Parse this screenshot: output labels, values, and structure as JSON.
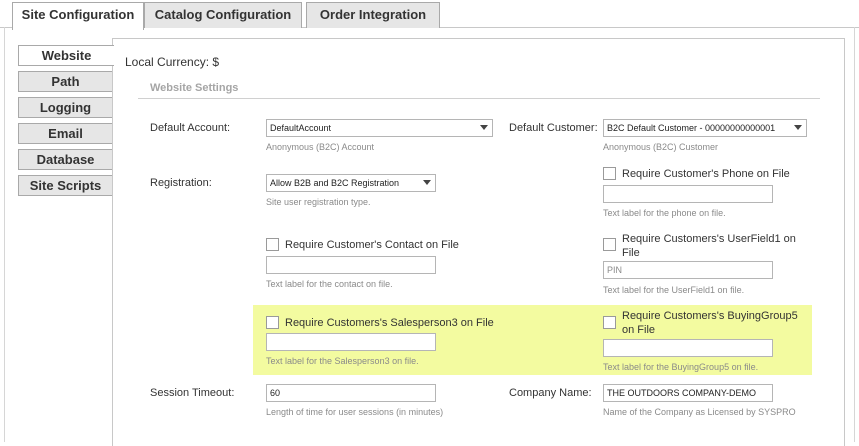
{
  "top_tabs": [
    "Site Configuration",
    "Catalog Configuration",
    "Order Integration"
  ],
  "side_tabs": [
    "Website",
    "Path",
    "Logging",
    "Email",
    "Database",
    "Site Scripts"
  ],
  "currency_label": "Local Currency: $",
  "section_title": "Website Settings",
  "default_account": {
    "label": "Default Account:",
    "value": "DefaultAccount",
    "hint": "Anonymous (B2C) Account"
  },
  "default_customer": {
    "label": "Default Customer:",
    "value": "B2C Default Customer - 00000000000001",
    "hint": "Anonymous (B2C) Customer"
  },
  "registration": {
    "label": "Registration:",
    "value": "Allow B2B and B2C Registration",
    "hint": "Site user registration type."
  },
  "phone": {
    "checkbox_label": "Require Customer's Phone on File",
    "value": "",
    "hint": "Text label for the phone on file."
  },
  "contact": {
    "checkbox_label": "Require Customer's Contact on File",
    "value": "",
    "hint": "Text label for the contact on file."
  },
  "userfield1": {
    "checkbox_label_1": "Require Customers's UserField1 on",
    "checkbox_label_2": "File",
    "value": "PIN",
    "hint": "Text label for the UserField1 on file."
  },
  "salesperson3": {
    "checkbox_label": "Require Customers's Salesperson3 on File",
    "value": "",
    "hint": "Text label for the Salesperson3 on file."
  },
  "buyinggroup5": {
    "checkbox_label_1": "Require Customers's BuyingGroup5",
    "checkbox_label_2": "on File",
    "value": "",
    "hint": "Text label for the BuyingGroup5 on file."
  },
  "session_timeout": {
    "label": "Session Timeout:",
    "value": "60",
    "hint": "Length of time for user sessions (in minutes)"
  },
  "company_name": {
    "label": "Company Name:",
    "value": "THE OUTDOORS COMPANY-DEMO",
    "hint": "Name of the Company as Licensed by SYSPRO"
  }
}
